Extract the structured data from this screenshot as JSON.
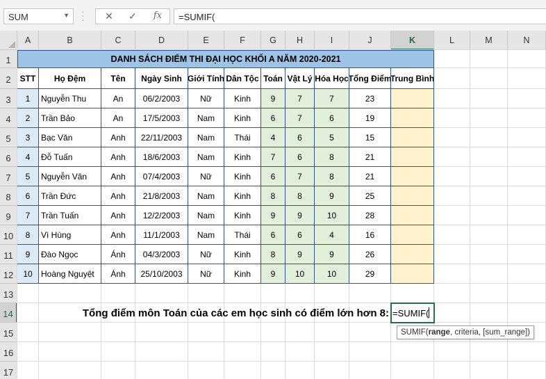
{
  "formula_bar": {
    "name_box": "SUM",
    "formula": "=SUMIF(",
    "cancel_icon": "✕",
    "enter_icon": "✓",
    "fx_label": "fx"
  },
  "columns": [
    "A",
    "B",
    "C",
    "D",
    "E",
    "F",
    "G",
    "H",
    "I",
    "J",
    "K",
    "L",
    "M",
    "N"
  ],
  "rows": [
    "1",
    "2",
    "3",
    "4",
    "5",
    "6",
    "7",
    "8",
    "9",
    "10",
    "11",
    "12",
    "13",
    "14",
    "15",
    "16",
    "17"
  ],
  "sheet": {
    "title": "DANH SÁCH ĐIỂM THI ĐẠI HỌC KHỐI A NĂM 2020-2021",
    "headers": [
      "STT",
      "Họ Đệm",
      "Tên",
      "Ngày Sinh",
      "Giới Tính",
      "Dân Tộc",
      "Toán",
      "Vật Lý",
      "Hóa Học",
      "Tổng Điểm",
      "Trung Bình"
    ],
    "students": [
      [
        "1",
        "Nguyễn Thu",
        "An",
        "06/2/2003",
        "Nữ",
        "Kinh",
        "9",
        "7",
        "7",
        "23"
      ],
      [
        "2",
        "Trần Bảo",
        "An",
        "17/5/2003",
        "Nam",
        "Kinh",
        "6",
        "7",
        "6",
        "19"
      ],
      [
        "3",
        "Bạc Văn",
        "Anh",
        "22/11/2003",
        "Nam",
        "Thái",
        "4",
        "6",
        "5",
        "15"
      ],
      [
        "4",
        "Đỗ Tuấn",
        "Anh",
        "18/6/2003",
        "Nam",
        "Kinh",
        "7",
        "6",
        "8",
        "21"
      ],
      [
        "5",
        "Nguyễn Vân",
        "Anh",
        "07/4/2003",
        "Nữ",
        "Kinh",
        "6",
        "7",
        "8",
        "21"
      ],
      [
        "6",
        "Trần Đức",
        "Anh",
        "21/8/2003",
        "Nam",
        "Kinh",
        "8",
        "8",
        "9",
        "25"
      ],
      [
        "7",
        "Trần Tuấn",
        "Anh",
        "12/2/2003",
        "Nam",
        "Kinh",
        "9",
        "9",
        "10",
        "28"
      ],
      [
        "8",
        "Vì Hùng",
        "Anh",
        "11/1/2003",
        "Nam",
        "Thái",
        "6",
        "6",
        "4",
        "16"
      ],
      [
        "9",
        "Đào Ngọc",
        "Ánh",
        "04/3/2003",
        "Nữ",
        "Kinh",
        "8",
        "9",
        "9",
        "26"
      ],
      [
        "10",
        "Hoàng Nguyệt",
        "Ánh",
        "25/10/2003",
        "Nữ",
        "Kinh",
        "9",
        "10",
        "10",
        "29"
      ]
    ],
    "question_label": "Tổng điểm môn Toán của các em học sinh có điểm lớn hơn 8:",
    "active_cell_value": "=SUMIF(",
    "active_cell_ref": "K14"
  },
  "tooltip": {
    "fn": "SUMIF(",
    "arg1": "range",
    "rest": ", criteria, [sum_range])"
  },
  "colors": {
    "accent": "#217346",
    "title_fill": "#9dc3e6",
    "stt_fill": "#ddebf7",
    "score_fill": "#e2efda",
    "average_fill": "#fff2cc"
  }
}
